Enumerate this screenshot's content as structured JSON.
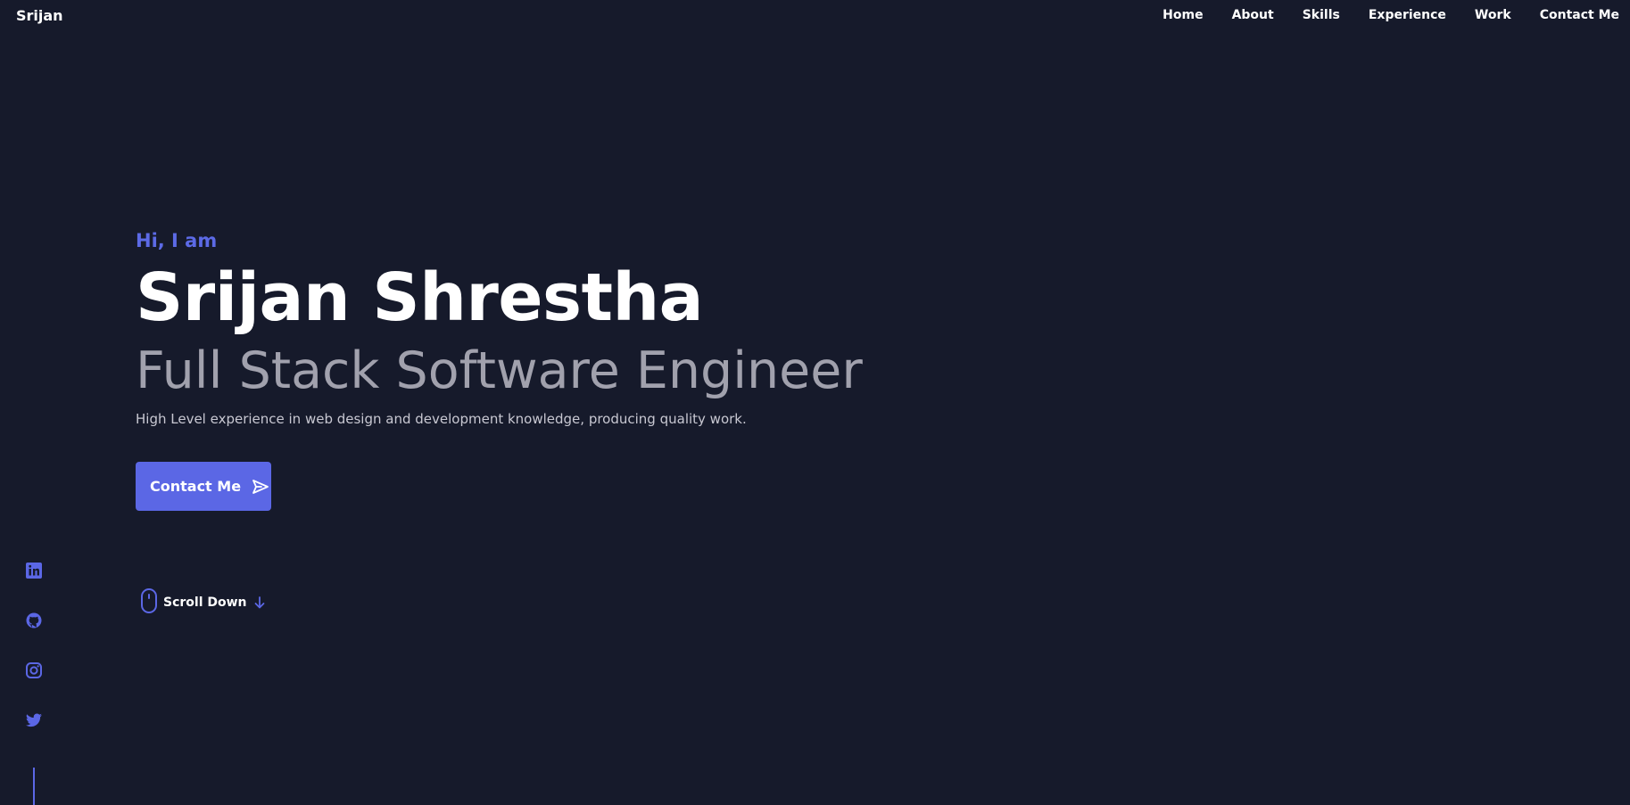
{
  "nav": {
    "logo": "Srijan",
    "links": [
      "Home",
      "About",
      "Skills",
      "Experience",
      "Work",
      "Contact Me"
    ]
  },
  "hero": {
    "greeting": "Hi, I am",
    "name": "Srijan Shrestha",
    "role": "Full Stack Software Engineer",
    "description": "High Level experience in web design and development knowledge, producing quality work.",
    "contact_button": "Contact Me",
    "scroll_label": "Scroll Down"
  },
  "socials": [
    "linkedin-icon",
    "github-icon",
    "instagram-icon",
    "twitter-icon"
  ],
  "colors": {
    "background": "#161a2b",
    "accent": "#5b67e5",
    "subtitle": "#a1a1ad"
  }
}
